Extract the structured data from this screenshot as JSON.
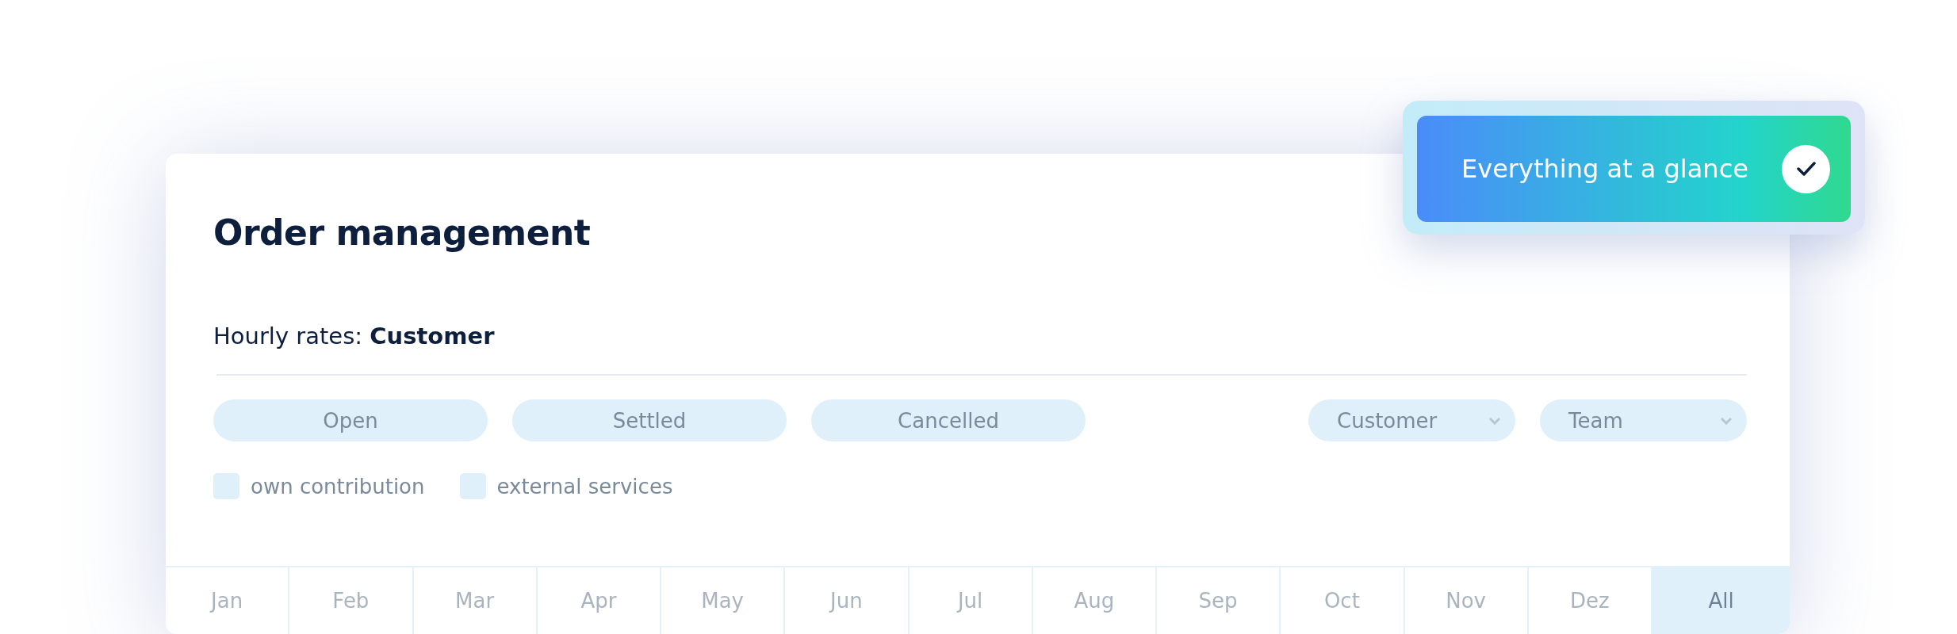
{
  "toast": {
    "text": "Everything at a glance"
  },
  "card": {
    "title": "Order management",
    "subtitle": "Hourly rates: **Customer**"
  },
  "status_filters": [
    {
      "label": "Open"
    },
    {
      "label": "Settled"
    },
    {
      "label": "Cancelled"
    }
  ],
  "dropdowns": [
    {
      "label": "Customer"
    },
    {
      "label": "Team"
    }
  ],
  "checkboxes": [
    {
      "label": "own contribution",
      "checked": false
    },
    {
      "label": "external services",
      "checked": false
    }
  ],
  "months": [
    {
      "label": "Jan",
      "selected": false
    },
    {
      "label": "Feb",
      "selected": false
    },
    {
      "label": "Mar",
      "selected": false
    },
    {
      "label": "Apr",
      "selected": false
    },
    {
      "label": "May",
      "selected": false
    },
    {
      "label": "Jun",
      "selected": false
    },
    {
      "label": "Jul",
      "selected": false
    },
    {
      "label": "Aug",
      "selected": false
    },
    {
      "label": "Sep",
      "selected": false
    },
    {
      "label": "Oct",
      "selected": false
    },
    {
      "label": "Nov",
      "selected": false
    },
    {
      "label": "Dez",
      "selected": false
    },
    {
      "label": "All",
      "selected": true
    }
  ]
}
